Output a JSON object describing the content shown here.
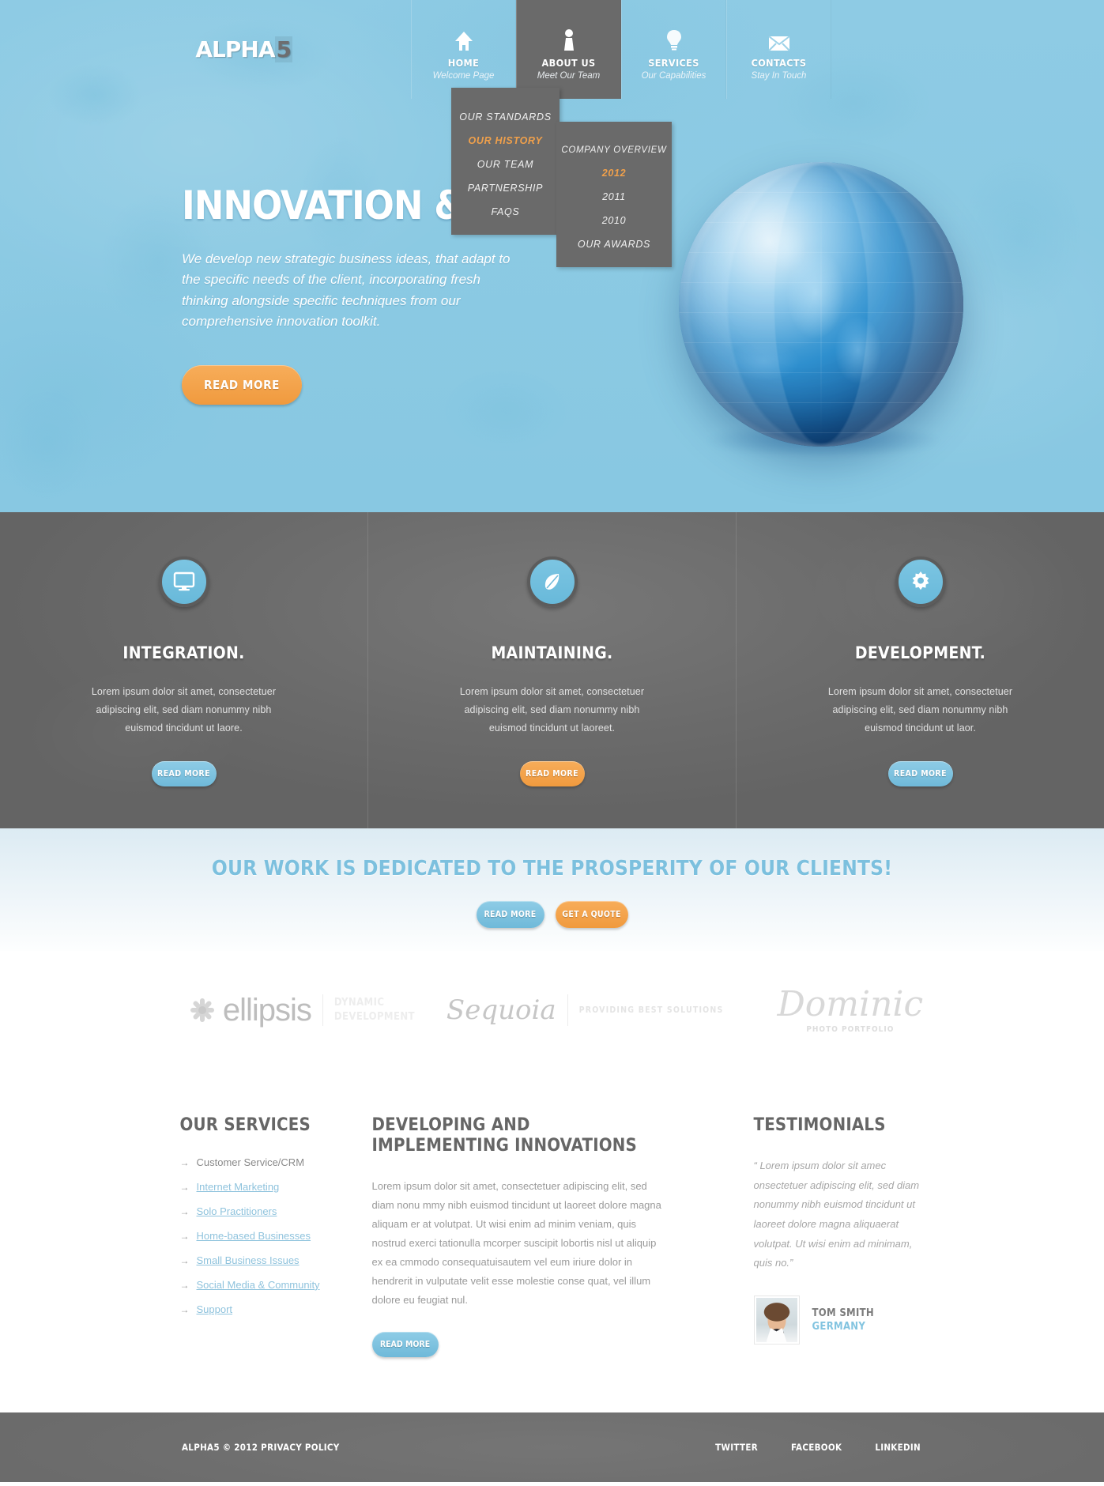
{
  "brand": {
    "name_part1": "ALPHA",
    "name_part2": "5"
  },
  "nav": {
    "items": [
      {
        "icon": "home-icon",
        "title": "HOME",
        "subtitle": "Welcome Page",
        "active": false
      },
      {
        "icon": "user-icon",
        "title": "ABOUT US",
        "subtitle": "Meet Our Team",
        "active": true
      },
      {
        "icon": "bulb-icon",
        "title": "SERVICES",
        "subtitle": "Our Capabilities",
        "active": false
      },
      {
        "icon": "envelope-icon",
        "title": "CONTACTS",
        "subtitle": "Stay In Touch",
        "active": false
      }
    ]
  },
  "dropdown_about": {
    "items": [
      {
        "label": "OUR STANDARDS",
        "current": false
      },
      {
        "label": "OUR HISTORY",
        "current": true
      },
      {
        "label": "OUR TEAM",
        "current": false
      },
      {
        "label": "PARTNERSHIP",
        "current": false
      },
      {
        "label": "FAQS",
        "current": false
      }
    ]
  },
  "dropdown_history": {
    "items": [
      {
        "label": "COMPANY OVERVIEW",
        "current": false
      },
      {
        "label": "2012",
        "current": true
      },
      {
        "label": "2011",
        "current": false
      },
      {
        "label": "2010",
        "current": false
      },
      {
        "label": "OUR AWARDS",
        "current": false
      }
    ]
  },
  "hero": {
    "title": "INNOVATION & WORK",
    "text": "We develop new strategic business ideas, that adapt to the specific needs of the client, incorporating fresh thinking alongside specific techniques from our comprehensive innovation toolkit.",
    "button": "READ MORE"
  },
  "features": [
    {
      "icon": "monitor-icon",
      "title": "INTEGRATION.",
      "text": "Lorem ipsum dolor sit amet, consectetuer adipiscing elit, sed diam nonummy nibh euismod tincidunt ut laore.",
      "button": "READ MORE",
      "button_style": "blue"
    },
    {
      "icon": "leaf-icon",
      "title": "MAINTAINING.",
      "text": "Lorem ipsum dolor sit amet, consectetuer adipiscing elit, sed diam nonummy nibh euismod tincidunt ut laoreet.",
      "button": "READ MORE",
      "button_style": "orange"
    },
    {
      "icon": "gear-icon",
      "title": "DEVELOPMENT.",
      "text": "Lorem ipsum dolor sit amet, consectetuer adipiscing elit, sed diam nonummy nibh euismod tincidunt ut laor.",
      "button": "READ MORE",
      "button_style": "blue"
    }
  ],
  "cta": {
    "heading": "OUR WORK IS DEDICATED TO THE PROSPERITY OF OUR CLIENTS!",
    "button_primary": "READ MORE",
    "button_secondary": "GET A QUOTE"
  },
  "partners": [
    {
      "name": "ellipsis",
      "tagline_line1": "DYNAMIC",
      "tagline_line2": "DEVELOPMENT"
    },
    {
      "name": "Sequoia",
      "tagline": "PROVIDING BEST SOLUTIONS"
    },
    {
      "name": "Dominic",
      "tagline": "PHOTO PORTFOLIO"
    }
  ],
  "services": {
    "heading": "OUR SERVICES",
    "items": [
      {
        "label": "Customer Service/CRM",
        "link": false
      },
      {
        "label": "Internet Marketing",
        "link": true
      },
      {
        "label": "Solo Practitioners",
        "link": true
      },
      {
        "label": "Home-based Businesses",
        "link": true
      },
      {
        "label": "Small Business Issues",
        "link": true
      },
      {
        "label": "Social Media & Community",
        "link": true
      },
      {
        "label": "Support",
        "link": true
      }
    ],
    "arrow": "→"
  },
  "developing": {
    "heading": "DEVELOPING AND IMPLEMENTING INNOVATIONS",
    "text": "Lorem ipsum dolor sit amet, consectetuer adipiscing elit, sed diam nonu mmy nibh euismod tincidunt ut laoreet dolore magna aliquam er at volutpat. Ut wisi enim ad minim veniam, quis nostrud exerci tationulla mcorper suscipit lobortis nisl ut aliquip ex ea cmmodo consequatuisautem vel eum iriure dolor in hendrerit in vulputate velit esse molestie conse quat, vel illum dolore eu feugiat nul.",
    "button": "READ MORE"
  },
  "testimonials": {
    "heading": "TESTIMONIALS",
    "quote": "“ Lorem ipsum dolor sit amec onsectetuer adipiscing elit, sed diam nonummy nibh euismod tincidunt ut laoreet dolore magna aliquaerat volutpat. Ut wisi enim ad minimam, quis no.”",
    "author_name": "TOM SMITH",
    "author_location": "GERMANY"
  },
  "footer": {
    "copyright": "ALPHA5 © 2012 PRIVACY POLICY",
    "social": [
      "TWITTER",
      "FACEBOOK",
      "LINKEDIN"
    ]
  },
  "colors": {
    "brand_blue": "#8ecbe4",
    "accent_orange": "#f0a04b",
    "dark_gray": "#6a6a6a"
  }
}
